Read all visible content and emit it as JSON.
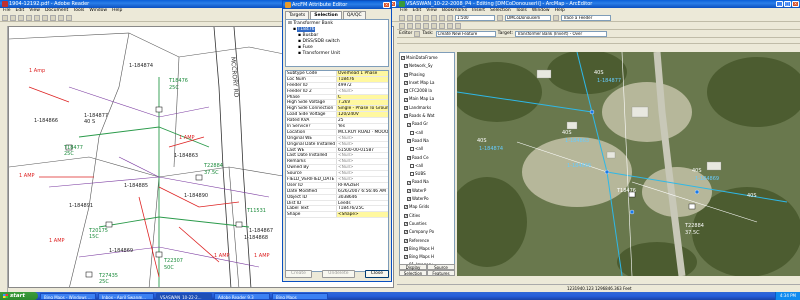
{
  "reader": {
    "title": "1904-12192.pdf - Adobe Reader",
    "menus": [
      "File",
      "Edit",
      "View",
      "Document",
      "Tools",
      "Window",
      "Help"
    ],
    "status_size": "35.96 × 24.13 in",
    "road_label": "MCCRORY RD",
    "labels": [
      {
        "text": "T18476",
        "cls": "g"
      },
      {
        "text": "25C",
        "cls": "g"
      },
      {
        "text": "1-184877",
        "cls": "k"
      },
      {
        "text": "40 S",
        "cls": "k"
      },
      {
        "text": "T18477",
        "cls": "g"
      },
      {
        "text": "25C",
        "cls": "g"
      },
      {
        "text": "T22884",
        "cls": "g"
      },
      {
        "text": "37.5C",
        "cls": "g"
      },
      {
        "text": "T20175",
        "cls": "g"
      },
      {
        "text": "15C",
        "cls": "g"
      },
      {
        "text": "T11531",
        "cls": "g"
      },
      {
        "text": "T22307",
        "cls": "g"
      },
      {
        "text": "50C",
        "cls": "g"
      },
      {
        "text": "T27435",
        "cls": "g"
      },
      {
        "text": "25C",
        "cls": "g"
      },
      {
        "text": "1 Amp",
        "cls": "r"
      },
      {
        "text": "1 AMP",
        "cls": "r"
      },
      {
        "text": "1 AMP",
        "cls": "r"
      },
      {
        "text": "1 AMP",
        "cls": "r"
      },
      {
        "text": "1 AMP",
        "cls": "r"
      },
      {
        "text": "1 AMP",
        "cls": "r"
      },
      {
        "text": "1-184874",
        "cls": "k"
      },
      {
        "text": "1-184885",
        "cls": "k"
      },
      {
        "text": "1-184890",
        "cls": "k"
      },
      {
        "text": "1-184863",
        "cls": "k"
      },
      {
        "text": "1-184866",
        "cls": "k"
      },
      {
        "text": "1-184867",
        "cls": "k"
      },
      {
        "text": "1-184868",
        "cls": "k"
      },
      {
        "text": "1-184869",
        "cls": "k"
      },
      {
        "text": "1-184891",
        "cls": "k"
      }
    ]
  },
  "attr": {
    "title": "ArcFM Attribute Editor",
    "tabs": [
      "Targets",
      "Selection",
      "QA/QC"
    ],
    "tree": [
      {
        "label": "Transformer Bank",
        "indent": 0
      },
      {
        "label": "T18476",
        "indent": 1,
        "selected": true
      },
      {
        "label": "Busbar",
        "indent": 2
      },
      {
        "label": "DISS/SDB switch",
        "indent": 2
      },
      {
        "label": "Fuse",
        "indent": 2
      },
      {
        "label": "Transformer Unit",
        "indent": 2
      }
    ],
    "props": [
      {
        "k": "Subtype Code",
        "v": "Overhead 1 Phase",
        "hl": true
      },
      {
        "k": "Loc Num",
        "v": "T18476",
        "hl": true
      },
      {
        "k": "Feeder ID",
        "v": "49972"
      },
      {
        "k": "Feeder ID 2",
        "v": "<Null>",
        "dim": true
      },
      {
        "k": "Phase",
        "v": "C",
        "hl": true
      },
      {
        "k": "High Side Voltage",
        "v": "7.2kV",
        "hl": true
      },
      {
        "k": "High Side Connection",
        "v": "Single - Phase To Groun",
        "hl": true
      },
      {
        "k": "Load Side Voltage",
        "v": "120/240V",
        "hl": true
      },
      {
        "k": "Rated KVA",
        "v": "25"
      },
      {
        "k": "In Service?",
        "v": "Yes"
      },
      {
        "k": "Location",
        "v": "MCCROY ROAD · MOOO"
      },
      {
        "k": "Original WE",
        "v": "<Null>",
        "dim": true
      },
      {
        "k": "Original Date Installed",
        "v": "<Null>",
        "dim": true
      },
      {
        "k": "Last WE",
        "v": "61500-00-01587"
      },
      {
        "k": "Last Date Installed",
        "v": "<Null>",
        "dim": true
      },
      {
        "k": "Remarks",
        "v": "<Null>",
        "dim": true
      },
      {
        "k": "Owned By",
        "v": "<Null>",
        "dim": true
      },
      {
        "k": "Source",
        "v": "<Null>",
        "dim": true
      },
      {
        "k": "FIELD_VERIFIED_DATE",
        "v": "<Null>",
        "dim": true
      },
      {
        "k": "User ID",
        "v": "RFRAZIER"
      },
      {
        "k": "Date Modified",
        "v": "6/26/2007 6:56:46 AM"
      },
      {
        "k": "Object ID",
        "v": "3038646"
      },
      {
        "k": "Dist ID",
        "v": "Leeds"
      },
      {
        "k": "Label Text",
        "v": "T18476/25C"
      },
      {
        "k": "Shape",
        "v": "<Shape>",
        "hl": true
      }
    ],
    "buttons": {
      "create": "Create",
      "undelete": "Undelete",
      "close": "Close"
    }
  },
  "arcmap": {
    "title": "VSASWAN_10-22-2008_P4 - Editing [DMCoDonouserli] - ArcMap - ArcEditor",
    "menus": [
      "File",
      "Edit",
      "View",
      "Bookmarks",
      "Insert",
      "Selection",
      "Tools",
      "Window",
      "Help"
    ],
    "scale": "1:500",
    "version": "DMCoDonouserli",
    "trace_label": "Trace a Feeder",
    "editor_label": "Editor",
    "task_label": "Task:",
    "task_value": "Create New Feature",
    "target_label": "Target:",
    "target_value": "Transformer Bank (Invert) - Over",
    "toc": [
      {
        "label": "MainDataFrame",
        "checked": true
      },
      {
        "label": "Network_Sy",
        "checked": true
      },
      {
        "label": "Phasing",
        "checked": true
      },
      {
        "label": "Inset Map La",
        "checked": true
      },
      {
        "label": "CFC2008 la",
        "checked": true
      },
      {
        "label": "Main Map La",
        "checked": true
      },
      {
        "label": "Landmarks",
        "checked": true
      },
      {
        "label": "Roads & Wat",
        "checked": true
      },
      {
        "label": "Road Gr",
        "checked": true
      },
      {
        "label": "<all",
        "checked": false
      },
      {
        "label": "Road Na",
        "checked": true
      },
      {
        "label": "<all",
        "checked": false
      },
      {
        "label": "Road Ce",
        "checked": true
      },
      {
        "label": "<all",
        "checked": false
      },
      {
        "label": "SUBS",
        "checked": false
      },
      {
        "label": "Road Na",
        "checked": true
      },
      {
        "label": "WaterP",
        "checked": true
      },
      {
        "label": "WaterPo",
        "checked": true
      },
      {
        "label": "Map Grids",
        "checked": true
      },
      {
        "label": "Cities",
        "checked": true
      },
      {
        "label": "Counties",
        "checked": true
      },
      {
        "label": "Company Po",
        "checked": true
      },
      {
        "label": "Reference",
        "checked": true
      },
      {
        "label": "Bing Maps H",
        "checked": true
      },
      {
        "label": "Bing Maps H",
        "checked": true
      },
      {
        "label": "01_Imagery_",
        "checked": true
      }
    ],
    "toc_tabs": [
      "Display",
      "Source",
      "Selection",
      "Features"
    ],
    "map_labels": [
      {
        "text": "40S",
        "c": "#fff"
      },
      {
        "text": "1-184877",
        "c": "#6cf"
      },
      {
        "text": "40S",
        "c": "#fff"
      },
      {
        "text": "1-184874",
        "c": "#6cf"
      },
      {
        "text": "40S",
        "c": "#fff"
      },
      {
        "text": "1-184863",
        "c": "#6cf"
      },
      {
        "text": "1-184866",
        "c": "#6cf"
      },
      {
        "text": "T18476",
        "c": "#fff"
      },
      {
        "text": "40S",
        "c": "#fff"
      },
      {
        "text": "1-184869",
        "c": "#6cf"
      },
      {
        "text": "T22884",
        "c": "#fff"
      },
      {
        "text": "37.5C",
        "c": "#fff"
      },
      {
        "text": "40S",
        "c": "#fff"
      }
    ],
    "coords": "1231940.123 1296846.363 Feet"
  },
  "taskbar": {
    "start": "start",
    "tasks": [
      "Bing Maps - Windows ...",
      "Inbox - April Swan@...",
      "VSASWAN_10-22-2...",
      "Adobe Reader 9.3",
      "Bing Maps"
    ],
    "active_index": 2,
    "clock": "4:34 PM"
  }
}
